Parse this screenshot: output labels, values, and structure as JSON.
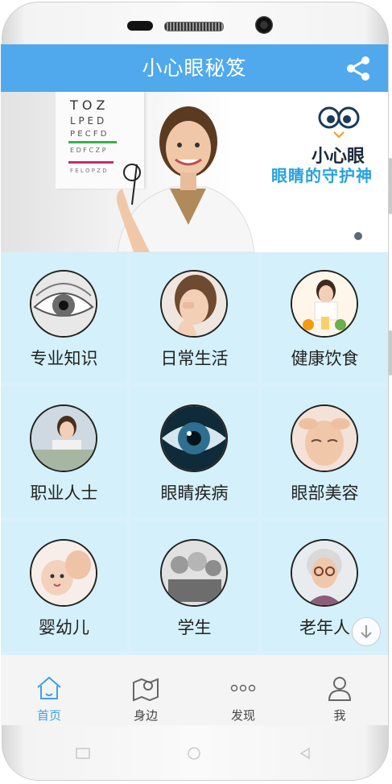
{
  "app": {
    "title": "小心眼秘笈"
  },
  "banner": {
    "brand_name": "小心眼",
    "tagline": "眼睛的守护神"
  },
  "categories": [
    {
      "label": "专业知识",
      "icon": "eye-closeup-icon"
    },
    {
      "label": "日常生活",
      "icon": "woman-rubbing-eyes-icon"
    },
    {
      "label": "健康饮食",
      "icon": "healthy-breakfast-icon"
    },
    {
      "label": "职业人士",
      "icon": "office-worker-icon"
    },
    {
      "label": "眼睛疾病",
      "icon": "eye-iris-icon"
    },
    {
      "label": "眼部美容",
      "icon": "eye-massage-icon"
    },
    {
      "label": "婴幼儿",
      "icon": "baby-icon"
    },
    {
      "label": "学生",
      "icon": "students-icon"
    },
    {
      "label": "老年人",
      "icon": "senior-woman-icon"
    }
  ],
  "tabs": [
    {
      "label": "首页",
      "icon": "home-icon",
      "active": true
    },
    {
      "label": "身边",
      "icon": "map-pin-icon",
      "active": false
    },
    {
      "label": "发现",
      "icon": "more-dots-icon",
      "active": false
    },
    {
      "label": "我",
      "icon": "user-icon",
      "active": false
    }
  ],
  "colors": {
    "accent": "#4fa9ec",
    "grid_bg": "#d4f0fa",
    "tab_active": "#3fa0ea"
  }
}
